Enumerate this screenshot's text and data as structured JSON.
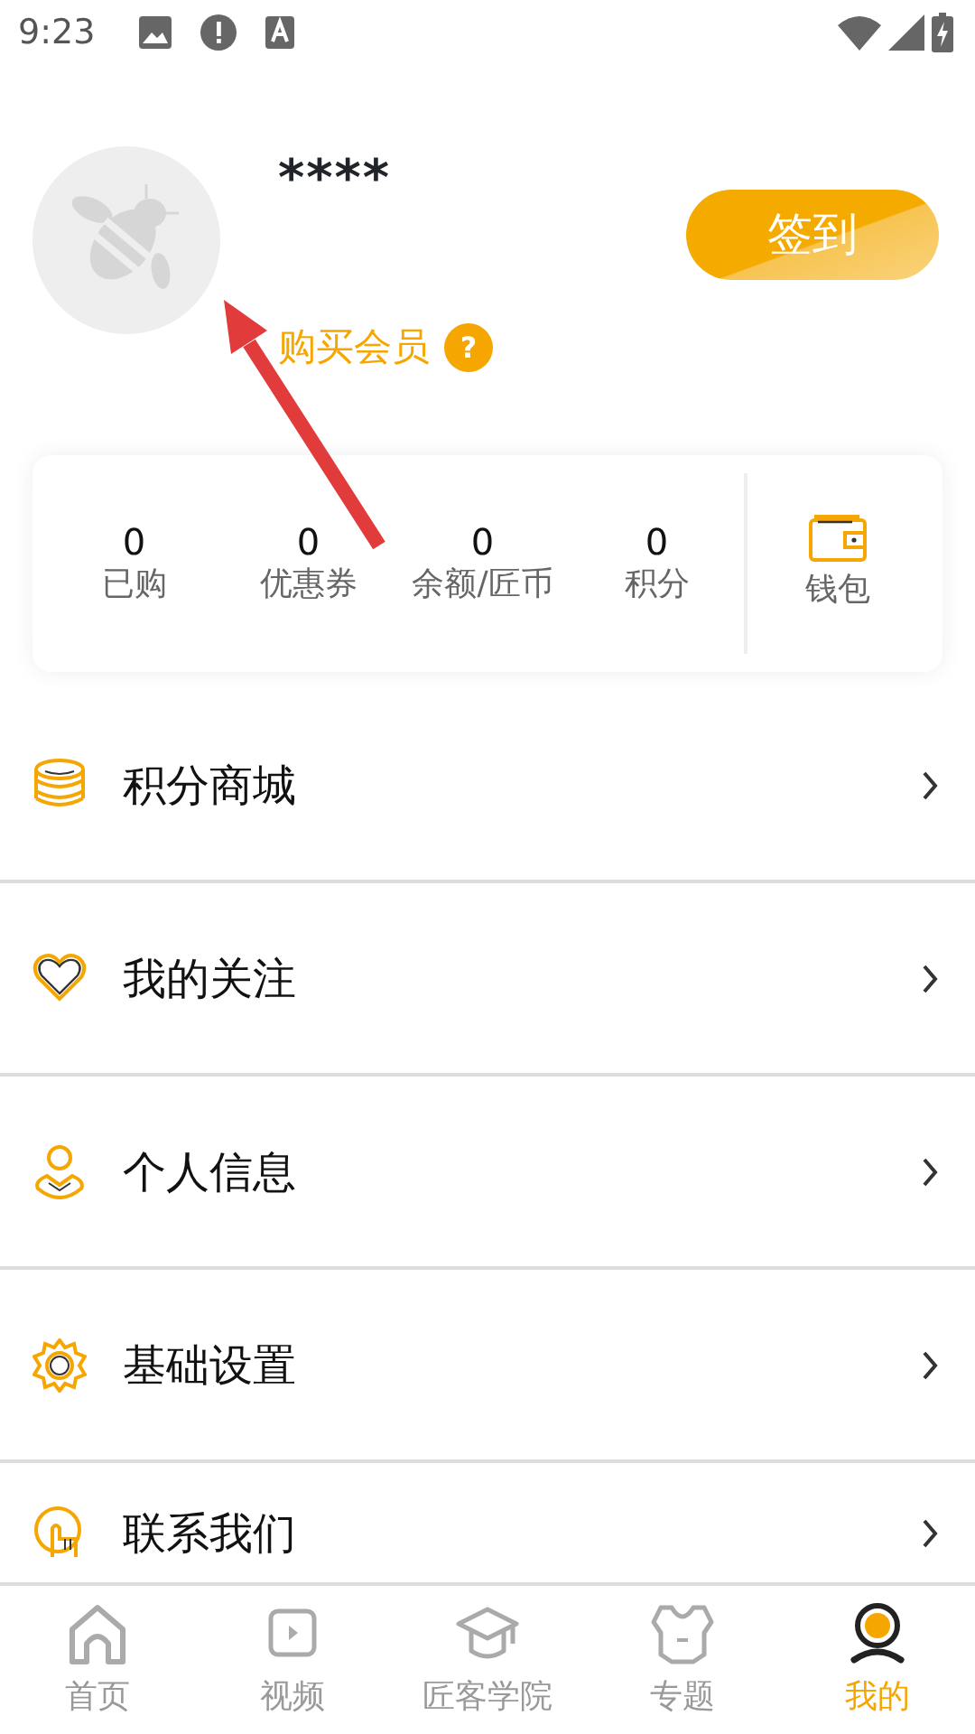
{
  "status_bar": {
    "time": "9:23"
  },
  "profile": {
    "name": "****",
    "member_link": "购买会员",
    "help_badge": "?",
    "checkin_button": "签到"
  },
  "stats": [
    {
      "value": "0",
      "label": "已购"
    },
    {
      "value": "0",
      "label": "优惠券"
    },
    {
      "value": "0",
      "label": "余额/匠币"
    },
    {
      "value": "0",
      "label": "积分"
    }
  ],
  "wallet": {
    "label": "钱包"
  },
  "menu": [
    {
      "label": "积分商城"
    },
    {
      "label": "我的关注"
    },
    {
      "label": "个人信息"
    },
    {
      "label": "基础设置"
    },
    {
      "label": "联系我们"
    }
  ],
  "tabs": [
    {
      "label": "首页",
      "selected": false
    },
    {
      "label": "视频",
      "selected": false
    },
    {
      "label": "匠客学院",
      "selected": false
    },
    {
      "label": "专题",
      "selected": false
    },
    {
      "label": "我的",
      "selected": true
    }
  ]
}
